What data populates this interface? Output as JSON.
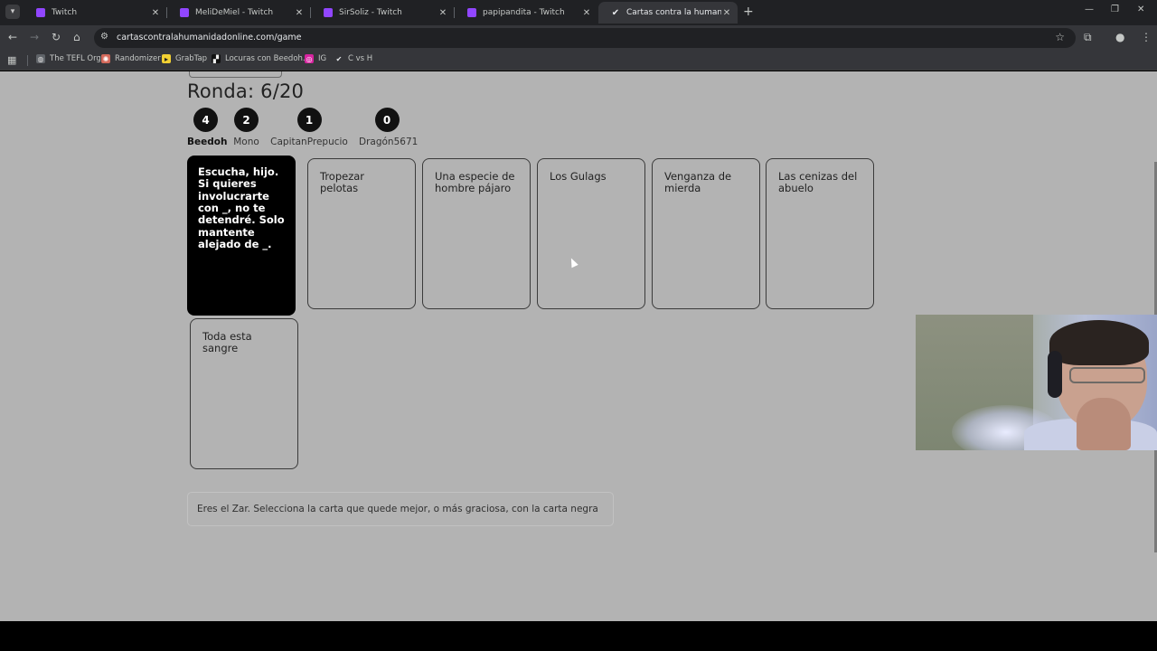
{
  "browser": {
    "tabs": [
      {
        "title": "Twitch",
        "active": false
      },
      {
        "title": "MeliDeMiel - Twitch",
        "active": false
      },
      {
        "title": "SirSoliz - Twitch",
        "active": false
      },
      {
        "title": "papipandita - Twitch",
        "active": false
      },
      {
        "title": "Cartas contra la humanidad onl",
        "active": true
      }
    ],
    "new_tab": "+",
    "url": "cartascontralahumanidadonline.com/game",
    "bookmarks": [
      {
        "label": "The TEFL Org",
        "icon": "globe-icon"
      },
      {
        "label": "Randomizer",
        "icon": "randomizer-icon"
      },
      {
        "label": "GrabTap",
        "icon": "grabtap-icon"
      },
      {
        "label": "Locuras con Beedoh...",
        "icon": "clapper-icon"
      },
      {
        "label": "IG",
        "icon": "instagram-icon"
      },
      {
        "label": "C vs H",
        "icon": "check-icon"
      }
    ]
  },
  "game": {
    "round_label": "Ronda: 6/20",
    "players": [
      {
        "name": "Beedoh",
        "score": "4",
        "is_me": true
      },
      {
        "name": "Mono",
        "score": "2",
        "is_me": false
      },
      {
        "name": "CapitanPrepucio",
        "score": "1",
        "is_me": false
      },
      {
        "name": "Dragón5671",
        "score": "0",
        "is_me": false
      }
    ],
    "black_card": "Escucha, hijo. Si quieres involucrarte con _, no te detendré. Solo mantente alejado de _.",
    "white_cards": [
      "Tropezar pelotas",
      "Una especie de hombre pájaro",
      "Los Gulags",
      "Venganza de mierda",
      "Las cenizas del abuelo",
      "Toda esta sangre"
    ],
    "instructions": "Eres el Zar. Selecciona la carta que quede mejor, o más graciosa, con la carta negra"
  },
  "colors": {
    "page_bg": "#b3b3b3",
    "black_card_bg": "#000000",
    "tab_accent": "#9146ff"
  }
}
